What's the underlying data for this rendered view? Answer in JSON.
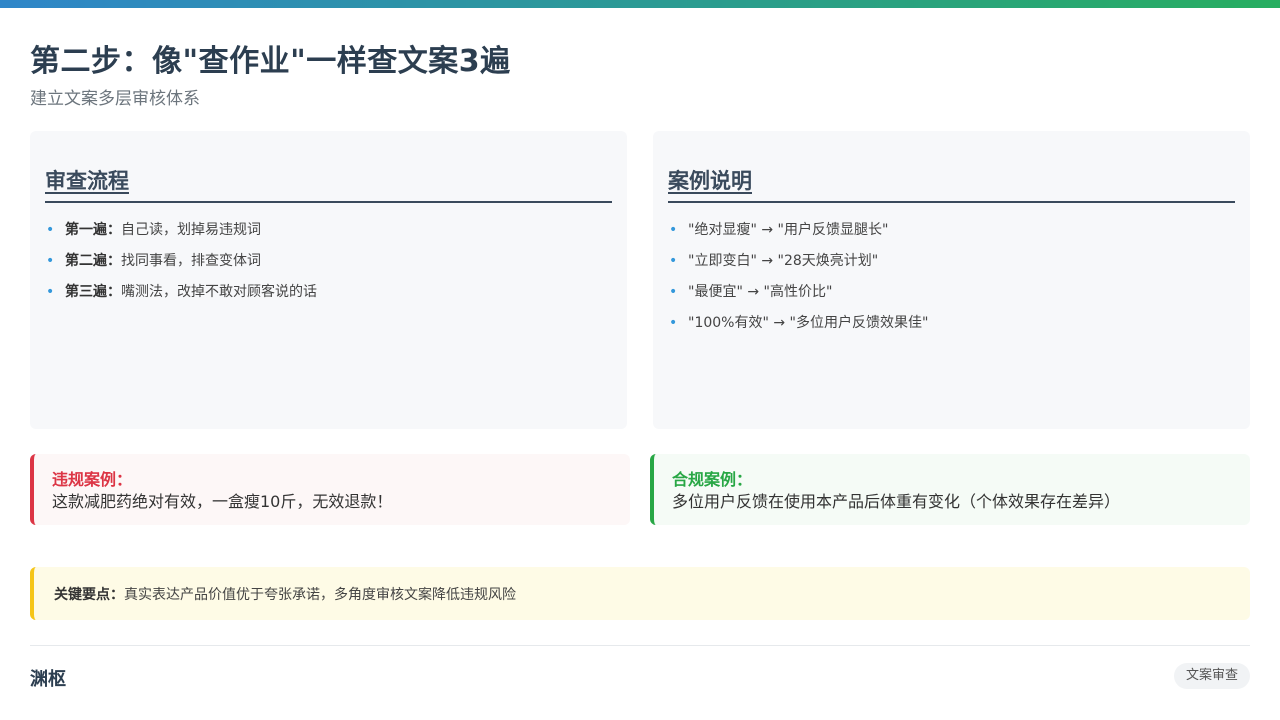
{
  "header": {
    "title": "第二步：像\"查作业\"一样查文案3遍",
    "subtitle": "建立文案多层审核体系"
  },
  "review_panel": {
    "title": "审查流程",
    "items": [
      {
        "label": "第一遍：",
        "text": "自己读，划掉易违规词"
      },
      {
        "label": "第二遍：",
        "text": "找同事看，排查变体词"
      },
      {
        "label": "第三遍：",
        "text": "嘴测法，改掉不敢对顾客说的话"
      }
    ]
  },
  "example_panel": {
    "title": "案例说明",
    "items": [
      "\"绝对显瘦\" → \"用户反馈显腿长\"",
      "\"立即变白\" → \"28天焕亮计划\"",
      "\"最便宜\" → \"高性价比\"",
      "\"100%有效\" → \"多位用户反馈效果佳\""
    ]
  },
  "cases": {
    "bad": {
      "label": "违规案例：",
      "text": "这款减肥药绝对有效，一盒瘦10斤，无效退款！"
    },
    "good": {
      "label": "合规案例：",
      "text": "多位用户反馈在使用本产品后体重有变化（个体效果存在差异）"
    }
  },
  "key_point": {
    "label": "关键要点：",
    "text": "真实表达产品价值优于夸张承诺，多角度审核文案降低违规风险"
  },
  "footer": {
    "brand": "渊枢",
    "tag": "文案审查"
  },
  "colors": {
    "accent_blue": "#2f86c9",
    "accent_green": "#27ae60",
    "violation_red": "#dc3545",
    "compliant_green": "#28a745",
    "key_yellow": "#f5c518"
  }
}
